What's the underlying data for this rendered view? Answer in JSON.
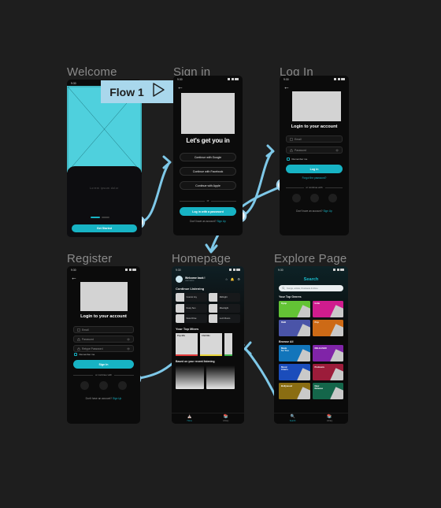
{
  "board": {
    "background": "#1e1e1e",
    "accent_cyan": "#17b3c4",
    "connector_blue": "#7ec8e8",
    "flow_badge_bg": "#a9d7ec"
  },
  "flow_badge": {
    "label": "Flow 1",
    "play_icon": "play-triangle-icon"
  },
  "frames": {
    "welcome": "Welcome",
    "signin": "Sign in",
    "login": "Log In",
    "register": "Register",
    "homepage": "Homepage",
    "explore": "Explore Page"
  },
  "status_bar": {
    "time": "9:30",
    "signal": "signal-icon",
    "wifi": "wifi-icon",
    "battery": "battery-icon"
  },
  "welcome": {
    "hero_alt": "image-placeholder",
    "body_text": "Lorem ipsum dolor",
    "progress": [
      "active",
      "inactive"
    ],
    "cta": "Get Started"
  },
  "signin": {
    "back": "back-arrow-icon",
    "image_alt": "image-placeholder",
    "heading": "Let's get you in",
    "buttons": [
      "Continue with Google",
      "Continue with Facebook",
      "Continue with Apple"
    ],
    "divider": "or",
    "primary_cta": "Log in with a password",
    "footer_text": "Don't have an account?",
    "footer_link": "Sign Up"
  },
  "login": {
    "back": "back-arrow-icon",
    "image_alt": "image-placeholder",
    "heading": "Login to your account",
    "fields": [
      {
        "name": "email",
        "placeholder": "Email",
        "icon": "mail-icon"
      },
      {
        "name": "password",
        "placeholder": "Password",
        "icon": "lock-icon",
        "trailing": "eye-icon"
      }
    ],
    "remember_me": "Remember me",
    "cta": "Log in",
    "forgot": "Forgot the password?",
    "divider": "or continue with",
    "socials": [
      "facebook-icon",
      "google-icon",
      "apple-icon"
    ],
    "footer_text": "Don't have an account?",
    "footer_link": "Sign Up"
  },
  "register": {
    "back": "back-arrow-icon",
    "image_alt": "image-placeholder",
    "heading": "Login to your account",
    "fields": [
      {
        "name": "email",
        "placeholder": "Email",
        "icon": "mail-icon"
      },
      {
        "name": "password",
        "placeholder": "Password",
        "icon": "lock-icon",
        "trailing": "eye-icon"
      },
      {
        "name": "retype",
        "placeholder": "Retype Password",
        "icon": "lock-icon",
        "trailing": "eye-icon"
      }
    ],
    "remember_me": "Remember me",
    "cta": "Sign In",
    "divider": "or continue with",
    "socials": [
      "facebook-icon",
      "google-icon",
      "apple-icon"
    ],
    "footer_text": "Don't have an account?",
    "footer_link": "Sign Up"
  },
  "homepage": {
    "greeting": "Welcome back !",
    "subtitle": "username",
    "header_icons": [
      "bookmark-icon",
      "bell-icon",
      "gear-icon"
    ],
    "section_continue": "Continue Listening",
    "continue_items": [
      "Cosmic Joy",
      "Midnight",
      "Dusty Sun",
      "Moonlight",
      "Neon Drive",
      "Lo-Fi Room"
    ],
    "section_mixes": "Your Top Mixes",
    "mixes": [
      {
        "label": "Pop Mix",
        "color": "#e03b3b"
      },
      {
        "label": "Chill Mix",
        "color": "#e8d43c"
      },
      {
        "label": "Jazz Mix",
        "color": "#3cb44a"
      }
    ],
    "section_recent": "Based on your recent listening",
    "nav": [
      {
        "label": "Home",
        "icon": "home-icon",
        "active": true
      },
      {
        "label": "Library",
        "icon": "library-icon",
        "active": false
      }
    ]
  },
  "explore": {
    "heading": "Search",
    "search_placeholder": "Songs, artists, Podcasts & More",
    "search_icon": "search-icon",
    "section_genres": "Your Top Genres",
    "genres": [
      {
        "label": "Kpop",
        "color": "#63c335"
      },
      {
        "label": "Indie",
        "color": "#cf1c8e"
      },
      {
        "label": "R&B",
        "color": "#4a54a8"
      },
      {
        "label": "Pop",
        "color": "#cd6a16"
      }
    ],
    "section_browse": "Browse All",
    "browse": [
      {
        "label": "Made\nfor You",
        "color": "#1275bb"
      },
      {
        "label": "RELEASED",
        "color": "#8024a8"
      },
      {
        "label": "Music\nCharts",
        "color": "#1b4dbb"
      },
      {
        "label": "Podcasts",
        "color": "#9c1c3a"
      },
      {
        "label": "Bollywood",
        "color": "#8a6d12"
      },
      {
        "label": "New\nRelease",
        "color": "#14664a"
      }
    ],
    "nav": [
      {
        "label": "Search",
        "icon": "search-icon",
        "active": true
      },
      {
        "label": "Library",
        "icon": "library-icon",
        "active": false
      }
    ]
  }
}
